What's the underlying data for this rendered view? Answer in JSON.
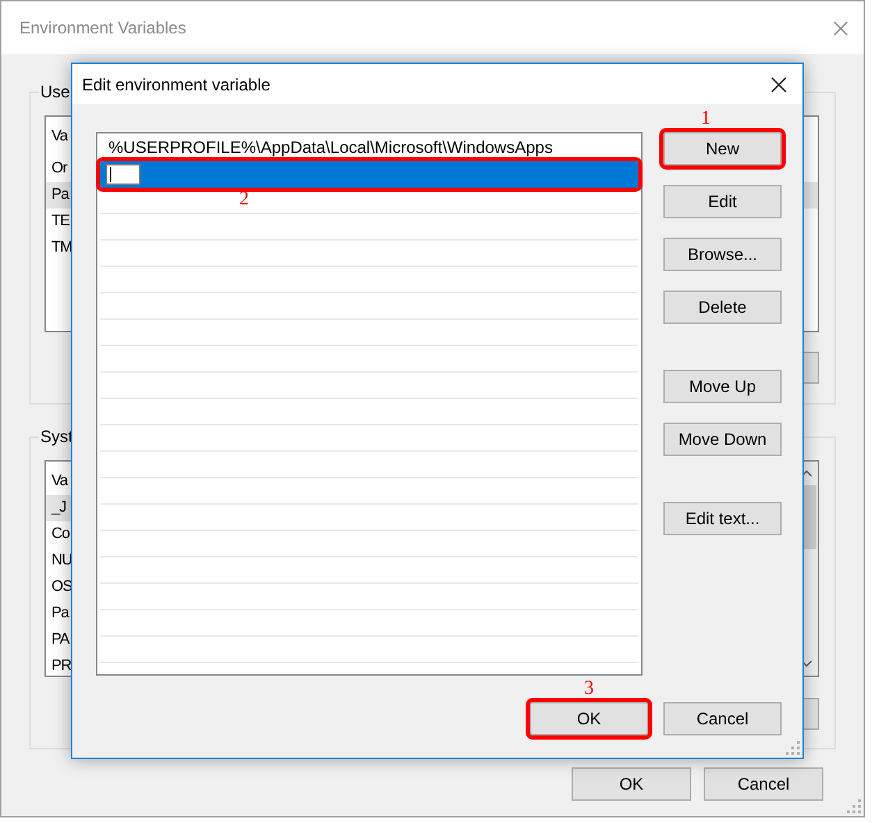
{
  "back_window": {
    "title": "Environment Variables",
    "user_group": {
      "label": "Use",
      "header": "Va",
      "rows": [
        {
          "text": "Or",
          "selected": false
        },
        {
          "text": "Pa",
          "selected": true
        },
        {
          "text": "TE",
          "selected": false
        },
        {
          "text": "TM",
          "selected": false
        }
      ]
    },
    "system_group": {
      "label": "Syst",
      "header": "Va",
      "rows": [
        {
          "text": "_J",
          "selected": true
        },
        {
          "text": "Co",
          "selected": false
        },
        {
          "text": "NU",
          "selected": false
        },
        {
          "text": "OS",
          "selected": false
        },
        {
          "text": "Pa",
          "selected": false
        },
        {
          "text": "PA",
          "selected": false
        },
        {
          "text": "PR",
          "selected": false
        }
      ]
    },
    "buttons": [
      "OK",
      "Cancel"
    ]
  },
  "dialog": {
    "title": "Edit environment variable",
    "rows": [
      {
        "kind": "text",
        "text": "%USERPROFILE%\\AppData\\Local\\Microsoft\\WindowsApps",
        "selected": false,
        "highlighted": false
      },
      {
        "kind": "editing",
        "selected": true,
        "highlighted": true,
        "annotation": "2"
      }
    ],
    "side_buttons": [
      [
        {
          "label": "New",
          "highlighted": true,
          "annotation": "1"
        },
        {
          "label": "Edit",
          "highlighted": false
        },
        {
          "label": "Browse...",
          "highlighted": false
        },
        {
          "label": "Delete",
          "highlighted": false
        }
      ],
      [
        {
          "label": "Move Up",
          "highlighted": false
        },
        {
          "label": "Move Down",
          "highlighted": false
        }
      ],
      [
        {
          "label": "Edit text...",
          "highlighted": false
        }
      ]
    ],
    "buttons": [
      {
        "label": "OK",
        "highlighted": true,
        "annotation": "3"
      },
      {
        "label": "Cancel",
        "highlighted": false
      }
    ]
  }
}
